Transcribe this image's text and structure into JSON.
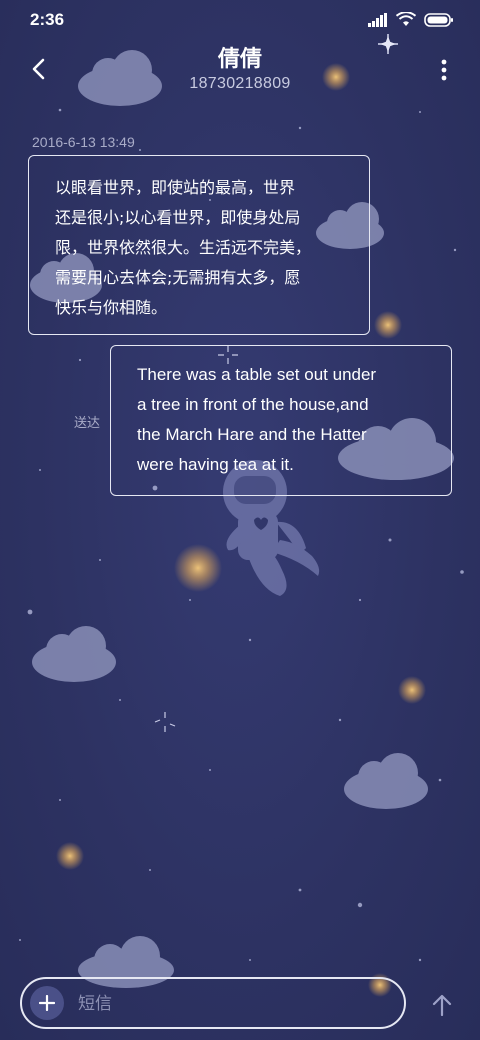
{
  "status_bar": {
    "time": "2:36",
    "icons": [
      "signal-icon",
      "wifi-icon",
      "battery-icon"
    ]
  },
  "header": {
    "back_icon": "chevron-left-icon",
    "contact_name": "倩倩",
    "contact_phone": "18730218809",
    "more_icon": "more-vertical-icon"
  },
  "conversation": {
    "timestamp": "2016-6-13 13:49",
    "messages": [
      {
        "direction": "incoming",
        "text": "以眼看世界，即使站的最高，世界\n还是很小;以心看世界，即使身处局\n限，世界依然很大。生活远不完美，\n需要用心去体会;无需拥有太多，愿\n快乐与你相随。"
      },
      {
        "direction": "outgoing",
        "text": "There was a table set out under\na tree in front of the house,and\nthe March Hare and the Hatter\nwere having tea at it.",
        "status": "送达"
      }
    ]
  },
  "composer": {
    "add_icon": "plus-icon",
    "placeholder": "短信",
    "value": "",
    "send_icon": "arrow-up-icon"
  },
  "theme": {
    "background": "#2f3566",
    "bubble_border": "#e6e8f3",
    "secondary_text": "#a9acc8",
    "cloud": "#8a8fb8",
    "star": "#e8b86a"
  }
}
